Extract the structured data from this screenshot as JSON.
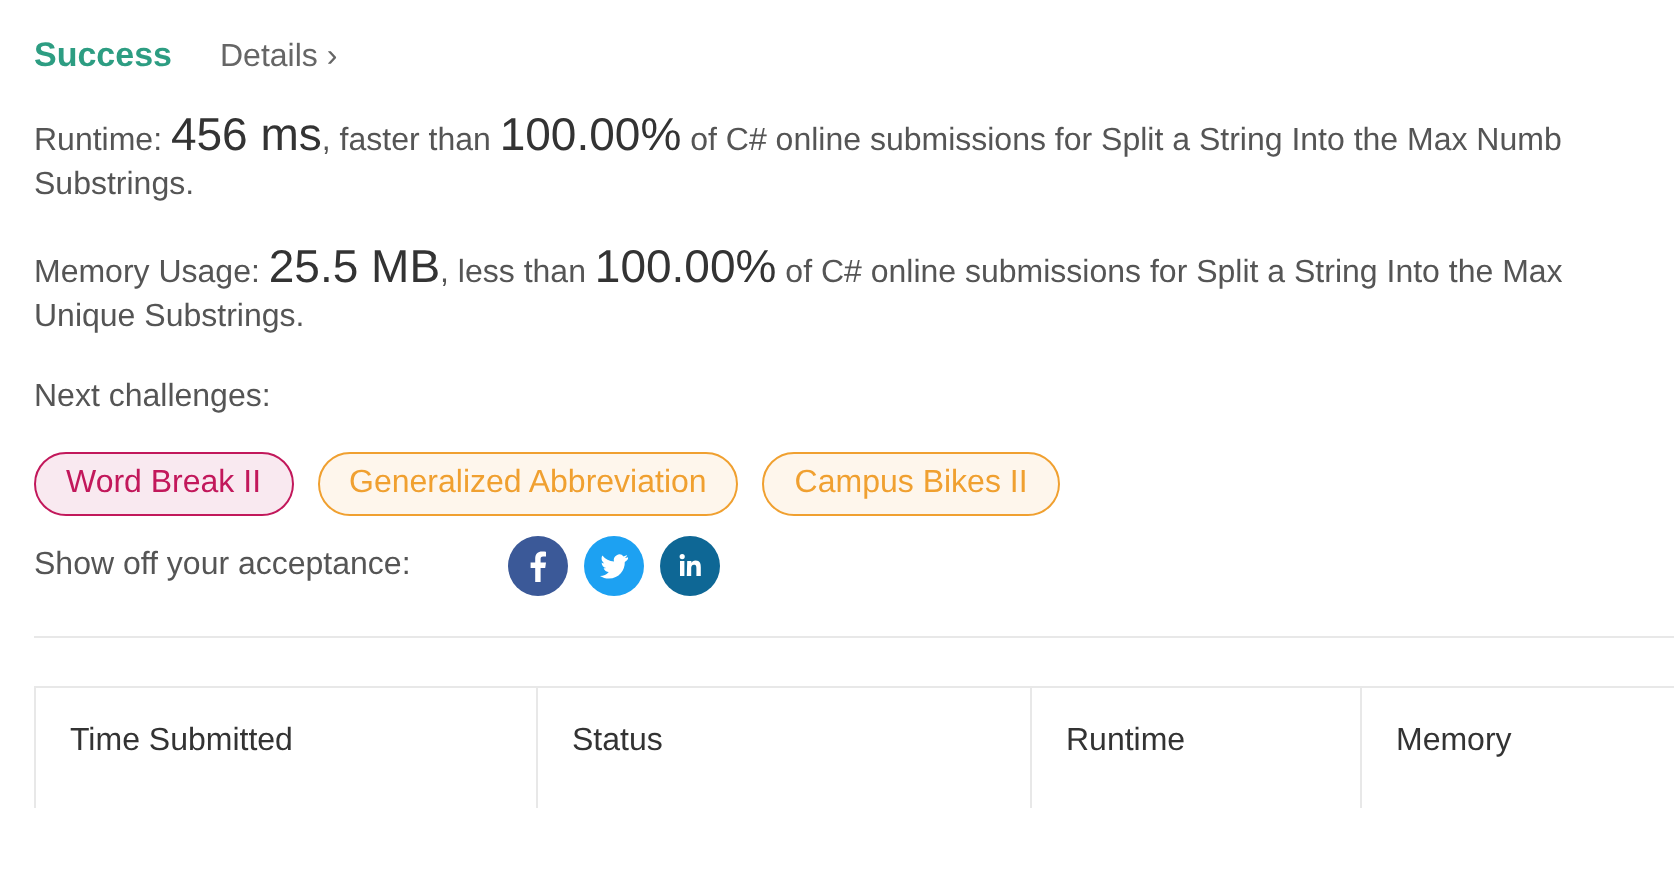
{
  "header": {
    "status": "Success",
    "details_link": "Details",
    "details_chevron": "›"
  },
  "stats": [
    {
      "label": "Runtime:",
      "value": "456 ms",
      "comparison": ", faster than",
      "percent": "100.00%",
      "rest": "of C# online submissions for Split a String Into the Max Numb",
      "continuation": "Substrings."
    },
    {
      "label": "Memory Usage:",
      "value": "25.5 MB",
      "comparison": ", less than",
      "percent": "100.00%",
      "rest": "of C# online submissions for Split a String Into the Max",
      "continuation": "Unique Substrings."
    }
  ],
  "next_challenges": {
    "label": "Next challenges:",
    "tags": [
      {
        "label": "Word Break II",
        "color": "#c2185b"
      },
      {
        "label": "Generalized Abbreviation",
        "color": "#f0a030"
      },
      {
        "label": "Campus Bikes II",
        "color": "#f0a030"
      }
    ]
  },
  "share": {
    "label": "Show off your acceptance:",
    "networks": [
      {
        "kind": "facebook"
      },
      {
        "kind": "twitter"
      },
      {
        "kind": "linkedin"
      }
    ]
  },
  "table": {
    "columns": [
      "Time Submitted",
      "Status",
      "Runtime",
      "Memory"
    ]
  }
}
